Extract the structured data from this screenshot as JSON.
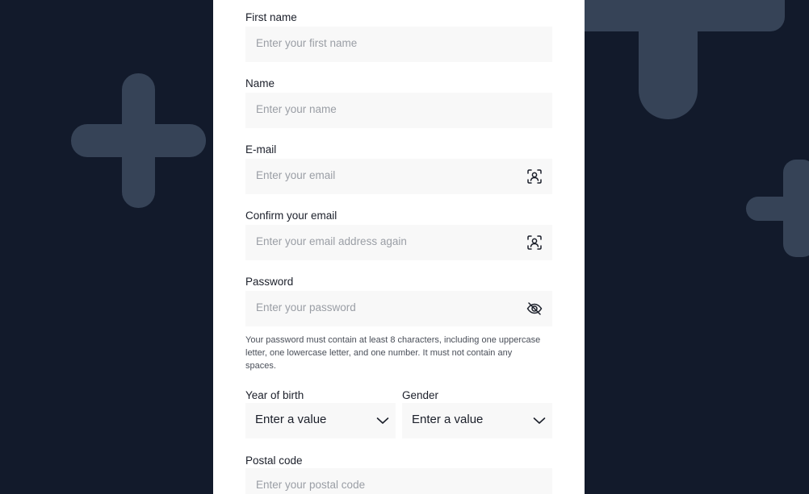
{
  "form": {
    "first_name": {
      "label": "First name",
      "placeholder": "Enter your first name"
    },
    "name": {
      "label": "Name",
      "placeholder": "Enter your name"
    },
    "email": {
      "label": "E-mail",
      "placeholder": "Enter your email",
      "icon": "contact-picker-icon"
    },
    "confirm_email": {
      "label": "Confirm your email",
      "placeholder": "Enter your email address again",
      "icon": "contact-picker-icon"
    },
    "password": {
      "label": "Password",
      "placeholder": "Enter your password",
      "icon": "eye-slash-icon"
    },
    "password_help": "Your password must contain at least 8 characters, including one uppercase letter, one lowercase letter, and one number. It must not contain any spaces.",
    "year_of_birth": {
      "label": "Year of birth",
      "value": "Enter a value"
    },
    "gender": {
      "label": "Gender",
      "value": "Enter a value"
    },
    "postal_code": {
      "label": "Postal code",
      "placeholder": "Enter your postal code"
    }
  },
  "colors": {
    "background": "#121a2b",
    "decoration": "#364357",
    "panel": "#ffffff",
    "input_bg": "#f8f8f8"
  }
}
